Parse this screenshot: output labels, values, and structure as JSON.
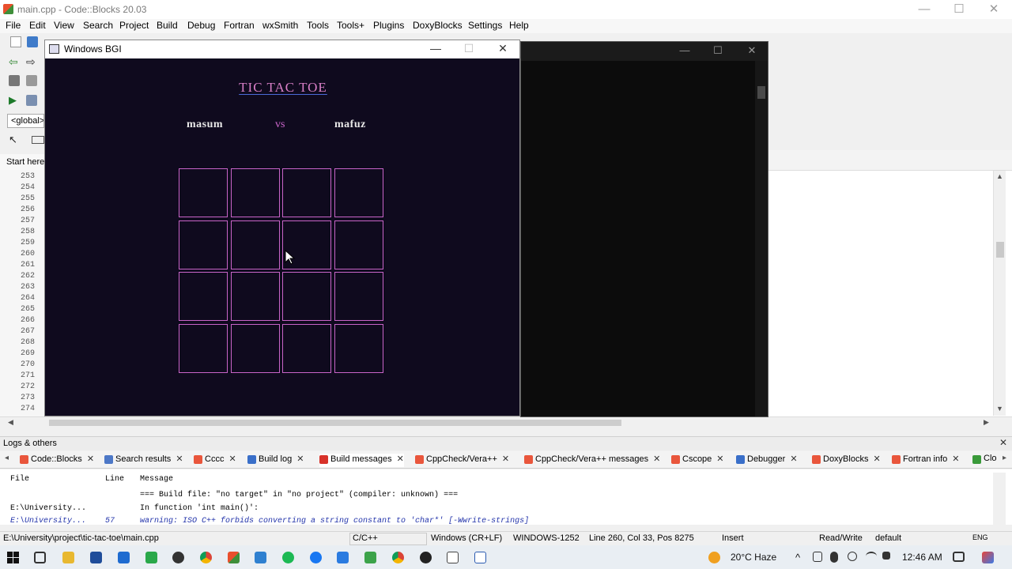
{
  "window": {
    "title": "main.cpp - Code::Blocks 20.03",
    "minimize": "—",
    "maximize": "☐",
    "close": "✕"
  },
  "menu": [
    "File",
    "Edit",
    "View",
    "Search",
    "Project",
    "Build",
    "Debug",
    "Fortran",
    "wxSmith",
    "Tools",
    "Tools+",
    "Plugins",
    "DoxyBlocks",
    "Settings",
    "Help"
  ],
  "toolbar": {
    "scope_select": "<global>"
  },
  "editor": {
    "start_tab": "Start here",
    "line_numbers": [
      "253",
      "254",
      "255",
      "256",
      "257",
      "258",
      "259",
      "260",
      "261",
      "262",
      "263",
      "264",
      "265",
      "266",
      "267",
      "268",
      "269",
      "270",
      "271",
      "272",
      "273",
      "274"
    ]
  },
  "bgi_window": {
    "title": "Windows BGI",
    "minimize": "—",
    "maximize": "☐",
    "close": "✕",
    "game_title": "TIC TAC TOE",
    "player1": "masum",
    "vs": "vs",
    "player2": "mafuz"
  },
  "console_window": {
    "minimize": "—",
    "maximize": "☐",
    "close": "✕"
  },
  "logs": {
    "header": "Logs & others",
    "close": "✕",
    "tabs": [
      {
        "label": "Code::Blocks",
        "color": "#e9563c"
      },
      {
        "label": "Search results",
        "color": "#4d78c7"
      },
      {
        "label": "Cccc",
        "color": "#e9563c"
      },
      {
        "label": "Build log",
        "color": "#3a6fc9"
      },
      {
        "label": "Build messages",
        "color": "#d8322a"
      },
      {
        "label": "CppCheck/Vera++",
        "color": "#e9563c"
      },
      {
        "label": "CppCheck/Vera++ messages",
        "color": "#e9563c"
      },
      {
        "label": "Cscope",
        "color": "#e9563c"
      },
      {
        "label": "Debugger",
        "color": "#3a6fc9"
      },
      {
        "label": "DoxyBlocks",
        "color": "#e9563c"
      },
      {
        "label": "Fortran info",
        "color": "#e9563c"
      },
      {
        "label": "Clo",
        "color": "#3a9a3a"
      }
    ],
    "columns": {
      "file": "File",
      "line": "Line",
      "message": "Message"
    },
    "rows": [
      {
        "file": "",
        "line": "",
        "message": "=== Build file: \"no target\" in \"no project\" (compiler: unknown) ==="
      },
      {
        "file": "E:\\University...",
        "line": "",
        "message": "In function 'int main()':"
      },
      {
        "file": "E:\\University...",
        "line": "57",
        "message": "warning: ISO C++ forbids converting a string constant to 'char*' [-Wwrite-strings]"
      }
    ]
  },
  "statusbar": {
    "path": "E:\\University\\project\\tic-tac-toe\\main.cpp",
    "language": "C/C++",
    "line_endings": "Windows (CR+LF)",
    "encoding": "WINDOWS-1252",
    "position": "Line 260, Col 33, Pos 8275",
    "mode": "Insert",
    "access": "Read/Write",
    "profile": "default"
  },
  "taskbar": {
    "weather": "20°C  Haze",
    "time": "12:46 AM",
    "tray_chevron": "^",
    "language": "ENG"
  },
  "colors": {
    "bgi_background": "#0f0a1e",
    "grid_line": "#c864c8",
    "game_title": "#d87fc7",
    "vs": "#cc66cc"
  }
}
